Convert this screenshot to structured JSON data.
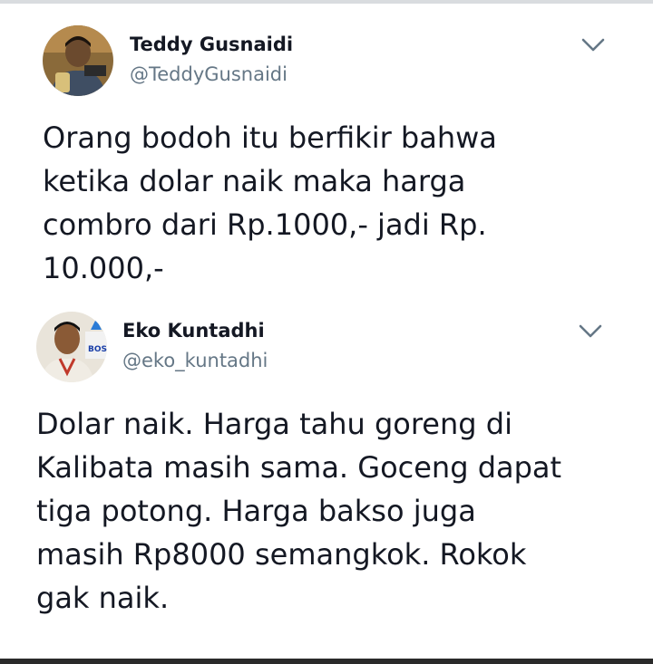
{
  "tweets": [
    {
      "name": "Teddy Gusnaidi",
      "handle": "@TeddyGusnaidi",
      "text_lines": [
        "Orang bodoh itu berfikir bahwa",
        "ketika dolar naik maka harga",
        "combro dari Rp.1000,- jadi Rp.",
        "10.000,-"
      ],
      "menu_icon": "chevron-down-icon"
    },
    {
      "name": "Eko Kuntadhi",
      "handle": "@eko_kuntadhi",
      "text_lines": [
        "Dolar naik. Harga tahu goreng di",
        "Kalibata masih sama. Goceng dapat",
        "tiga potong. Harga bakso juga",
        "masih Rp8000 semangkok. Rokok",
        "gak naik."
      ],
      "menu_icon": "chevron-down-icon"
    }
  ],
  "colors": {
    "text": "#141823",
    "handle": "#657786",
    "chevron": "#657786"
  }
}
